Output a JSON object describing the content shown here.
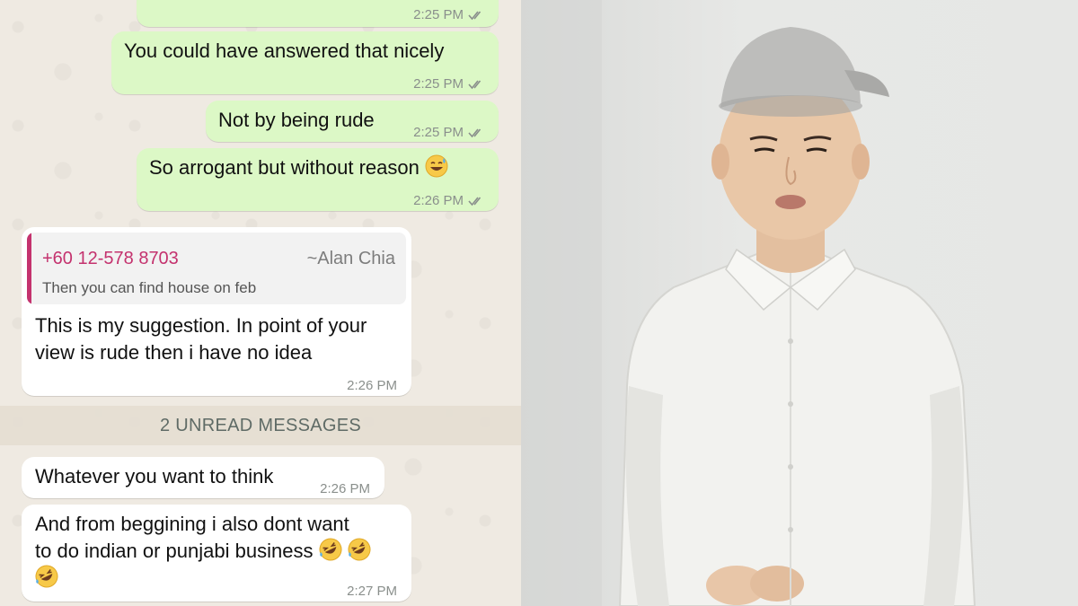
{
  "chat": {
    "messages": [
      {
        "id": "m0",
        "text": "",
        "time": "2:25 PM"
      },
      {
        "id": "m1",
        "text": "You could have answered that nicely",
        "time": "2:25 PM"
      },
      {
        "id": "m2",
        "text": "Not by being rude",
        "time": "2:25 PM"
      },
      {
        "id": "m3",
        "text": "So arrogant but without reason",
        "time": "2:26 PM",
        "emoji": "sweat-smile"
      },
      {
        "id": "m4",
        "quote": {
          "phone": "+60 12-578 8703",
          "name": "~Alan Chia",
          "text": "Then you can find house on feb"
        },
        "lines": [
          "This is my suggestion. In point of your",
          "view is rude then i have no idea"
        ],
        "time": "2:26 PM"
      },
      {
        "id": "m5",
        "text": "Whatever you want to think",
        "time": "2:26 PM"
      },
      {
        "id": "m6",
        "lines": [
          "And from beggining i also dont want",
          "to do indian or punjabi business"
        ],
        "emoji": "rolling-laughing",
        "time": "2:27 PM"
      }
    ],
    "unread_banner": "2 UNREAD MESSAGES"
  },
  "colors": {
    "outgoing_bubble": "#dcf8c6",
    "incoming_bubble": "#ffffff",
    "quote_accent": "#c4326e",
    "chat_background": "#efeae2",
    "read_ticks": "#8a8f8c"
  },
  "icons": {
    "read_receipt": "double-check-icon",
    "emoji_1": "sweat-smile-emoji",
    "emoji_2": "rolling-on-floor-laughing-emoji"
  }
}
